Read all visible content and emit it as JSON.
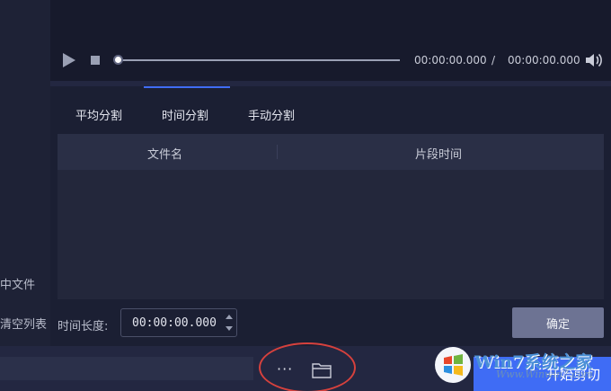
{
  "left_panel": {
    "item1": "中文件",
    "item2": "清空列表"
  },
  "player": {
    "current_time": "00:00:00.000",
    "separator": "/",
    "total_time": "00:00:00.000",
    "progress": 0,
    "icons": [
      "play-icon",
      "stop-icon",
      "volume-icon"
    ]
  },
  "tabs": [
    {
      "label": "平均分割",
      "active": false
    },
    {
      "label": "时间分割",
      "active": true
    },
    {
      "label": "手动分割",
      "active": false
    }
  ],
  "table": {
    "columns": [
      "文件名",
      "片段时间"
    ],
    "rows": []
  },
  "duration": {
    "label": "时间长度:",
    "value": "00:00:00.000"
  },
  "confirm_button": "确定",
  "bottom": {
    "more_label": "···",
    "start_button": "开始剪切"
  },
  "watermark": {
    "text": "Win7系统之家",
    "sub": "Www.Winwin7.com"
  },
  "colors": {
    "accent": "#3f6cf5",
    "highlight": "#d6413d",
    "panel": "#1b1f33"
  }
}
